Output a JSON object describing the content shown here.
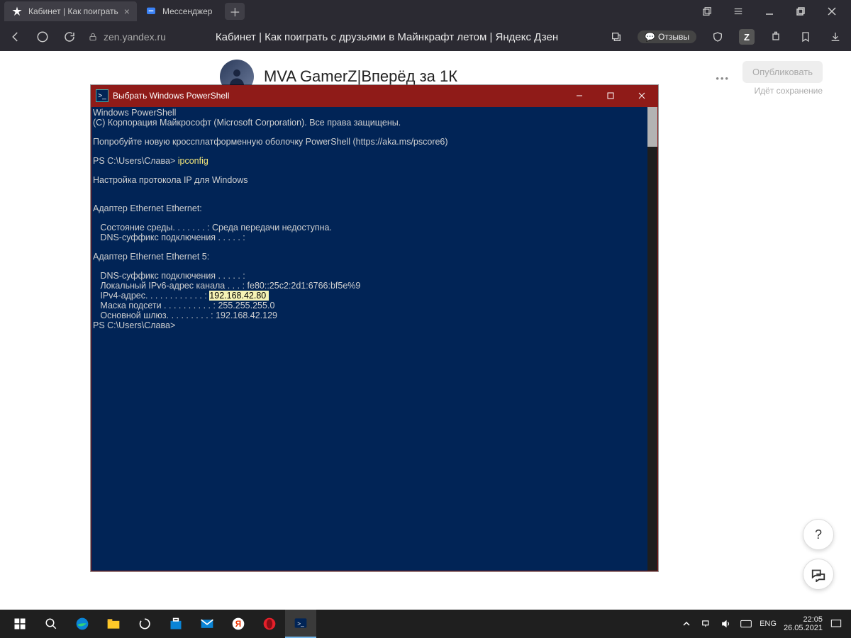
{
  "browser": {
    "tabs": [
      {
        "label": "Кабинет | Как поиграть",
        "active": true,
        "favicon": "zen-star"
      },
      {
        "label": "Мессенджер",
        "active": false,
        "favicon": "chat"
      }
    ],
    "url_host": "zen.yandex.ru",
    "page_title": "Кабинет | Как поиграть с друзьями в Майнкрафт летом | Яндекс Дзен",
    "reviews_label": "Отзывы",
    "icon_chip_letter": "Z"
  },
  "zen": {
    "channel_title": "MVA GamerZ|Вперёд за 1К",
    "publish_label": "Опубликовать",
    "saving_text": "Идёт сохранение"
  },
  "powershell": {
    "title": "Выбрать Windows PowerShell",
    "line_header1": "Windows PowerShell",
    "line_header2": "(C) Корпорация Майкрософт (Microsoft Corporation). Все права защищены.",
    "line_try": "Попробуйте новую кроссплатформенную оболочку PowerShell (https://aka.ms/pscore6)",
    "prompt1_prefix": "PS C:\\Users\\Слава> ",
    "prompt1_cmd": "ipconfig",
    "cfg_title": "Настройка протокола IP для Windows",
    "adapter1_title": "Адаптер Ethernet Ethernet:",
    "adapter1_state": "   Состояние среды. . . . . . . : Среда передачи недоступна.",
    "adapter1_dns": "   DNS-суффикс подключения . . . . . :",
    "adapter2_title": "Адаптер Ethernet Ethernet 5:",
    "adapter2_dns": "   DNS-суффикс подключения . . . . . :",
    "adapter2_ipv6": "   Локальный IPv6-адрес канала . . . : fe80::25c2:2d1:6766:bf5e%9",
    "adapter2_ipv4_label": "   IPv4-адрес. . . . . . . . . . . . : ",
    "adapter2_ipv4_value": "192.168.42.80 ",
    "adapter2_mask": "   Маска подсети . . . . . . . . . . : 255.255.255.0",
    "adapter2_gw": "   Основной шлюз. . . . . . . . . : 192.168.42.129",
    "prompt2": "PS C:\\Users\\Слава>"
  },
  "taskbar": {
    "lang": "ENG",
    "time": "22:05",
    "date": "26.05.2021"
  },
  "floating": {
    "help": "?",
    "chat": ""
  }
}
